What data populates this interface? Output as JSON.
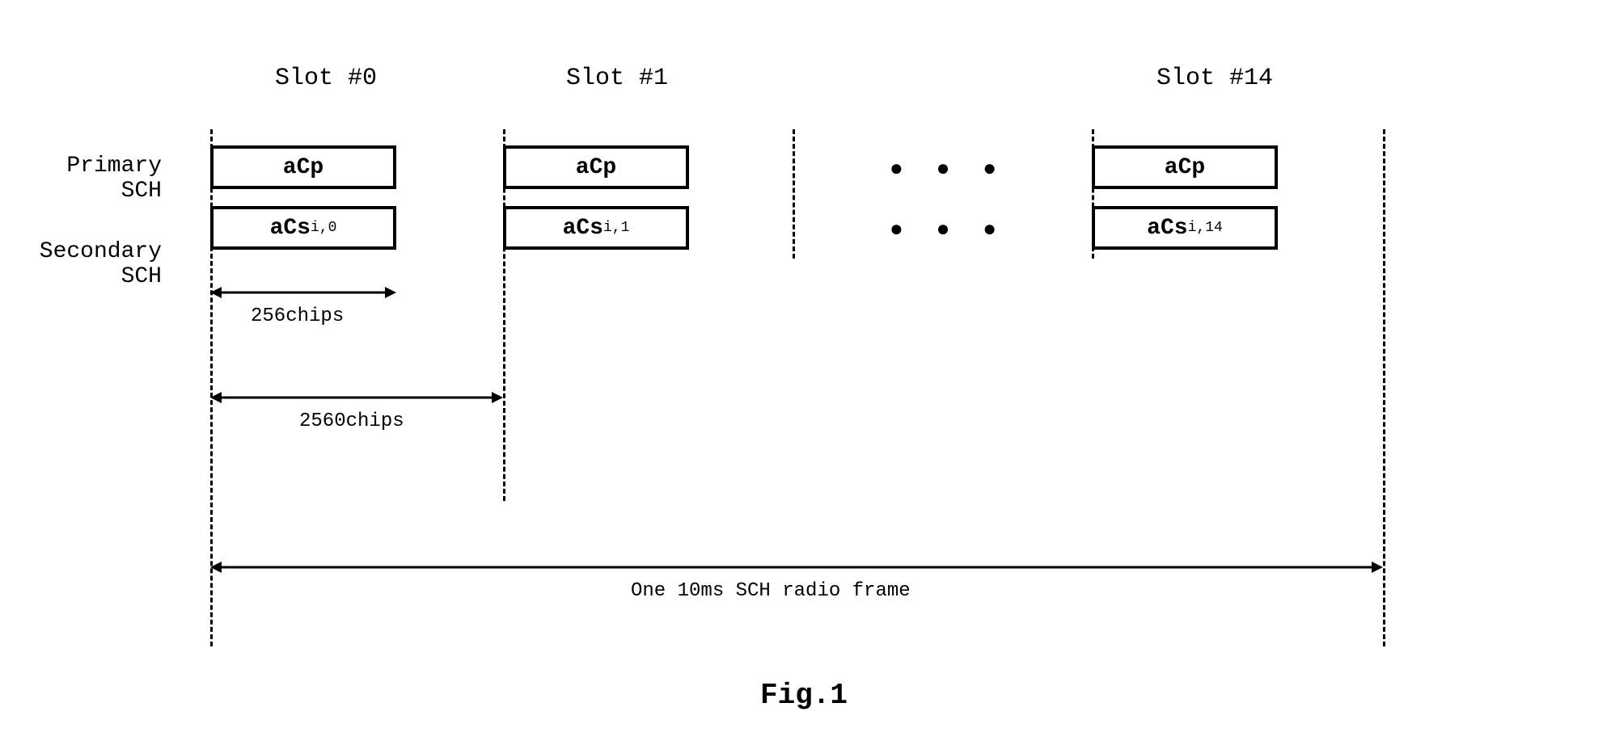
{
  "slot_headers": {
    "s0": "Slot #0",
    "s1": "Slot #1",
    "s14": "Slot #14"
  },
  "row_labels": {
    "primary": "Primary SCH",
    "secondary": "Secondary SCH"
  },
  "boxes": {
    "p0": "aCp",
    "p1": "aCp",
    "p14": "aCp",
    "s0_prefix": "aCs",
    "s0_suffix": " i,0",
    "s1_prefix": "aCs",
    "s1_suffix": " i,1",
    "s14_prefix": "aCs",
    "s14_suffix": " i,14"
  },
  "dots": "● ● ●",
  "arrows": {
    "chips256": "256chips",
    "chips2560": "2560chips",
    "frame": "One 10ms SCH radio frame"
  },
  "caption": "Fig.1"
}
